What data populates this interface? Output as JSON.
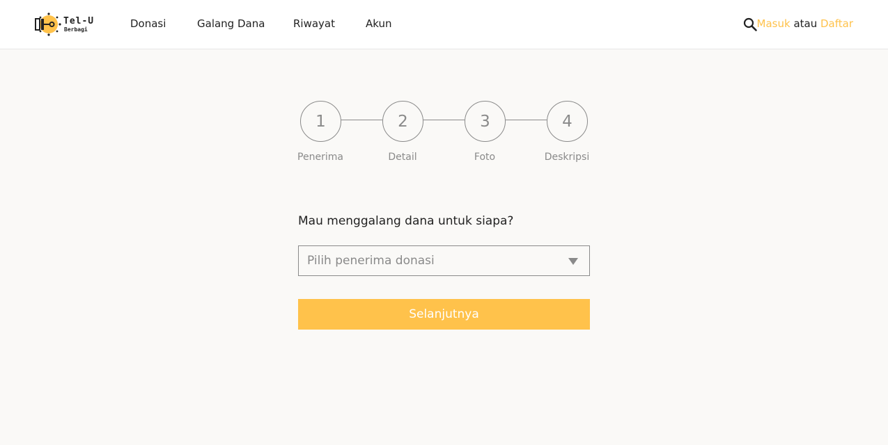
{
  "header": {
    "logo": {
      "title": "Tel-U",
      "subtitle": "Berbagi",
      "icon": "tel-u-logo-icon"
    },
    "nav": [
      {
        "label": "Donasi"
      },
      {
        "label": "Galang Dana"
      },
      {
        "label": "Riwayat"
      },
      {
        "label": "Akun"
      }
    ],
    "search_icon": "search-icon",
    "auth": {
      "login": "Masuk",
      "separator": "atau",
      "register": "Daftar"
    }
  },
  "stepper": {
    "steps": [
      {
        "number": "1",
        "label": "Penerima"
      },
      {
        "number": "2",
        "label": "Detail"
      },
      {
        "number": "3",
        "label": "Foto"
      },
      {
        "number": "4",
        "label": "Deskripsi"
      }
    ]
  },
  "form": {
    "question": "Mau menggalang dana untuk siapa?",
    "recipient_select": {
      "placeholder": "Pilih penerima donasi",
      "icon": "chevron-down-icon"
    },
    "next_button": "Selanjutnya"
  },
  "colors": {
    "accent": "#ffc24b",
    "muted": "#8a8a8a",
    "text": "#222222",
    "background": "#faf9f7",
    "header_bg": "#ffffff"
  }
}
